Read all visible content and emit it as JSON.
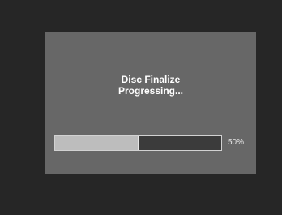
{
  "dialog": {
    "message_line1": "Disc Finalize",
    "message_line2": "Progressing..."
  },
  "progress": {
    "value": 0.5,
    "percent_label": "50%"
  },
  "colors": {
    "screen_background": "#262626",
    "dialog_background": "#676767",
    "progress_fill": "#bdbdbd",
    "progress_track": "#3b3b3b",
    "text": "#ffffff"
  }
}
